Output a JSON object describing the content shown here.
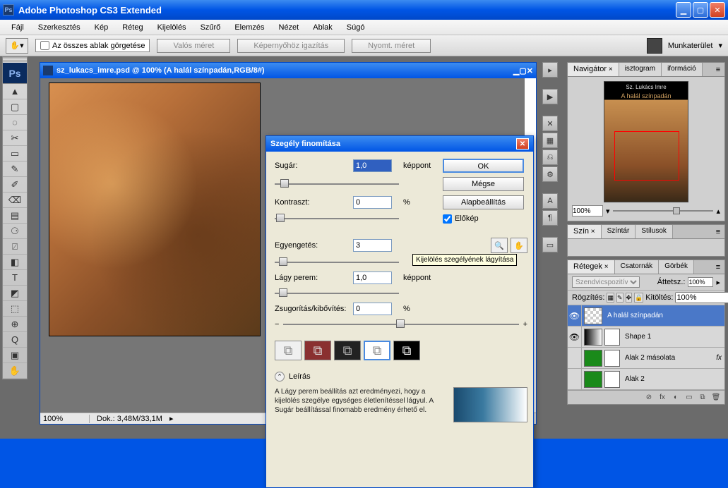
{
  "app": {
    "title": "Adobe Photoshop CS3 Extended",
    "logo": "Ps"
  },
  "menu": [
    "Fájl",
    "Szerkesztés",
    "Kép",
    "Réteg",
    "Kijelölés",
    "Szűrő",
    "Elemzés",
    "Nézet",
    "Ablak",
    "Súgó"
  ],
  "optbar": {
    "scroll_all": "Az összes ablak görgetése",
    "btn1": "Valós méret",
    "btn2": "Képernyőhöz igazítás",
    "btn3": "Nyomt. méret",
    "workspace": "Munkaterület"
  },
  "tools": [
    "▲",
    "▢",
    "◌",
    "✂",
    "▭",
    "✎",
    "✐",
    "⌫",
    "▤",
    "⚆",
    "⍁",
    "◧",
    "T",
    "◩",
    "⬚",
    "⊕",
    "Q",
    "▣",
    "✋"
  ],
  "doc": {
    "title": "sz_lukacs_imre.psd @ 100% (A halál színpadán,RGB/8#)",
    "zoom": "100%",
    "info": "Dok.: 3,48M/33,1M"
  },
  "dialog": {
    "title": "Szegély finomítása",
    "radius_lbl": "Sugár:",
    "radius_val": "1,0",
    "radius_unit": "képpont",
    "contrast_lbl": "Kontraszt:",
    "contrast_val": "0",
    "contrast_unit": "%",
    "smooth_lbl": "Egyengetés:",
    "smooth_val": "3",
    "feather_lbl": "Lágy perem:",
    "feather_val": "1,0",
    "feather_unit": "képpont",
    "expand_lbl": "Zsugorítás/kibővítés:",
    "expand_val": "0",
    "expand_unit": "%",
    "ok": "OK",
    "cancel": "Mégse",
    "default": "Alapbeállítás",
    "preview": "Előkép",
    "desc_label": "Leírás",
    "desc_text": "A Lágy perem beállítás azt eredményezi, hogy a kijelölés szegélye egységes életlenítéssel lágyul. A Sugár beállítással finomabb eredmény érhető el.",
    "tooltip": "Kijelölés szegélyének lágyítása",
    "minus": "−",
    "plus": "+"
  },
  "sidebtns": [
    "▸",
    "▶",
    "✕",
    "▦",
    "⎌",
    "⚙",
    "A",
    "¶",
    "▭"
  ],
  "nav": {
    "tabs": [
      "Navigátor",
      "isztogram",
      "iformáció"
    ],
    "thumb_author": "Sz. Lukács Imre",
    "thumb_title": "A halál színpadán",
    "zoom": "100%"
  },
  "color": {
    "tabs": [
      "Szín",
      "Színtár",
      "Stílusok"
    ]
  },
  "layers": {
    "tabs": [
      "Rétegek",
      "Csatornák",
      "Görbék"
    ],
    "blend": "Szendvicspozitív",
    "opacity_lbl": "Áttetsz.:",
    "opacity": "100%",
    "lock_lbl": "Rögzítés:",
    "fill_lbl": "Kitöltés:",
    "fill": "100%",
    "items": [
      {
        "name": "A halál színpadán",
        "sel": true,
        "eye": "👁"
      },
      {
        "name": "Shape 1",
        "sel": false,
        "eye": "👁"
      },
      {
        "name": "Alak 2 másolata",
        "sel": false,
        "eye": "",
        "fx": "fx"
      },
      {
        "name": "Alak 2",
        "sel": false,
        "eye": ""
      }
    ],
    "bottom": [
      "⊘",
      "fx",
      "◐",
      "▭",
      "⧉",
      "🗑"
    ]
  }
}
